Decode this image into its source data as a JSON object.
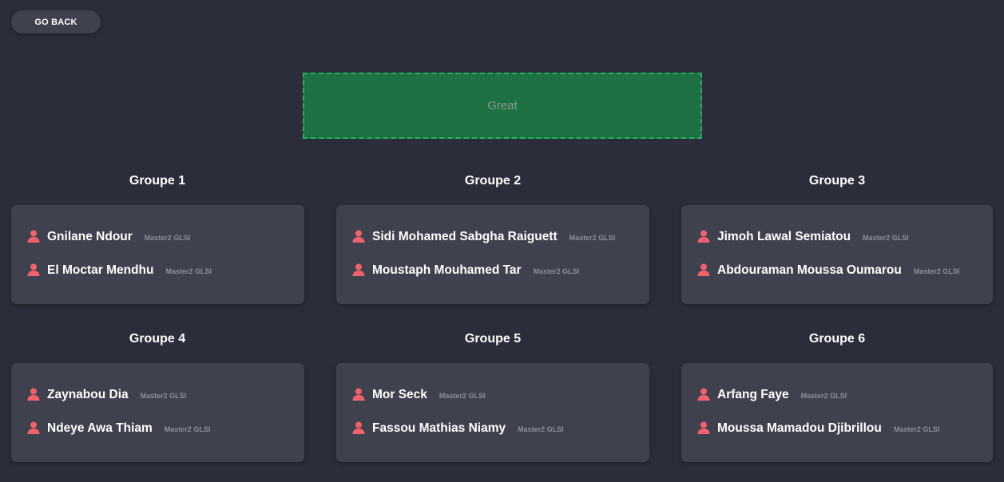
{
  "header": {
    "go_back_label": "GO BACK"
  },
  "status": {
    "message": "Great",
    "color": "#1e7143"
  },
  "colors": {
    "background": "#2b2e3a",
    "card": "#40414f",
    "icon": "#f0636b"
  },
  "groups": [
    {
      "title": "Groupe 1",
      "members": [
        {
          "name": "Gnilane Ndour",
          "class": "Master2 GLSI",
          "icon": "user-icon"
        },
        {
          "name": "El Moctar Mendhu",
          "class": "Master2 GLSI",
          "icon": "user-icon"
        }
      ]
    },
    {
      "title": "Groupe 2",
      "members": [
        {
          "name": "Sidi Mohamed Sabgha Raiguett",
          "class": "Master2 GLSI",
          "icon": "user-icon"
        },
        {
          "name": "Moustaph Mouhamed Tar",
          "class": "Master2 GLSI",
          "icon": "user-icon"
        }
      ]
    },
    {
      "title": "Groupe 3",
      "members": [
        {
          "name": "Jimoh Lawal Semiatou",
          "class": "Master2 GLSI",
          "icon": "user-icon"
        },
        {
          "name": "Abdouraman Moussa Oumarou",
          "class": "Master2 GLSI",
          "icon": "user-icon"
        }
      ]
    },
    {
      "title": "Groupe 4",
      "members": [
        {
          "name": "Zaynabou Dia",
          "class": "Master2 GLSI",
          "icon": "user-icon"
        },
        {
          "name": "Ndeye Awa Thiam",
          "class": "Master2 GLSI",
          "icon": "user-icon"
        }
      ]
    },
    {
      "title": "Groupe 5",
      "members": [
        {
          "name": "Mor Seck",
          "class": "Master2 GLSI",
          "icon": "user-icon"
        },
        {
          "name": "Fassou Mathias Niamy",
          "class": "Master2 GLSI",
          "icon": "user-icon"
        }
      ]
    },
    {
      "title": "Groupe 6",
      "members": [
        {
          "name": "Arfang Faye",
          "class": "Master2 GLSI",
          "icon": "user-icon"
        },
        {
          "name": "Moussa Mamadou Djibrillou",
          "class": "Master2 GLSI",
          "icon": "user-icon"
        }
      ]
    }
  ]
}
